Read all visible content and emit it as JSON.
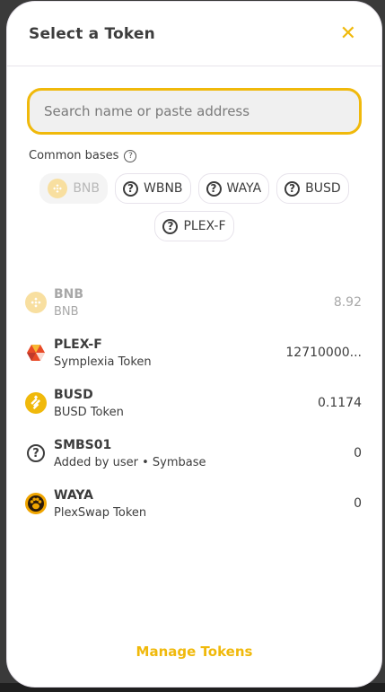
{
  "modal": {
    "title": "Select a Token",
    "close_glyph": "✕"
  },
  "search": {
    "placeholder": "Search name or paste address",
    "value": ""
  },
  "common_bases": {
    "label": "Common bases",
    "help_glyph": "?",
    "items": [
      {
        "label": "BNB",
        "icon": "bnb-icon",
        "disabled": true
      },
      {
        "label": "WBNB",
        "icon": "question-icon"
      },
      {
        "label": "WAYA",
        "icon": "question-icon"
      },
      {
        "label": "BUSD",
        "icon": "question-icon"
      },
      {
        "label": "PLEX-F",
        "icon": "question-icon"
      }
    ]
  },
  "tokens": [
    {
      "symbol": "BNB",
      "name": "BNB",
      "balance": "8.92",
      "icon": "bnb-icon",
      "disabled": true
    },
    {
      "symbol": "PLEX-F",
      "name": "Symplexia Token",
      "balance": "12710000...",
      "icon": "plex-icon"
    },
    {
      "symbol": "BUSD",
      "name": "BUSD Token",
      "balance": "0.1174",
      "icon": "busd-icon"
    },
    {
      "symbol": "SMBS01",
      "name": "Added by user • Symbase",
      "balance": "0",
      "icon": "question-icon"
    },
    {
      "symbol": "WAYA",
      "name": "PlexSwap Token",
      "balance": "0",
      "icon": "waya-icon"
    }
  ],
  "footer": {
    "manage_label": "Manage Tokens"
  },
  "colors": {
    "accent": "#f0b90b",
    "text": "#3d3d3d",
    "disabled": "#a8a8a8"
  }
}
